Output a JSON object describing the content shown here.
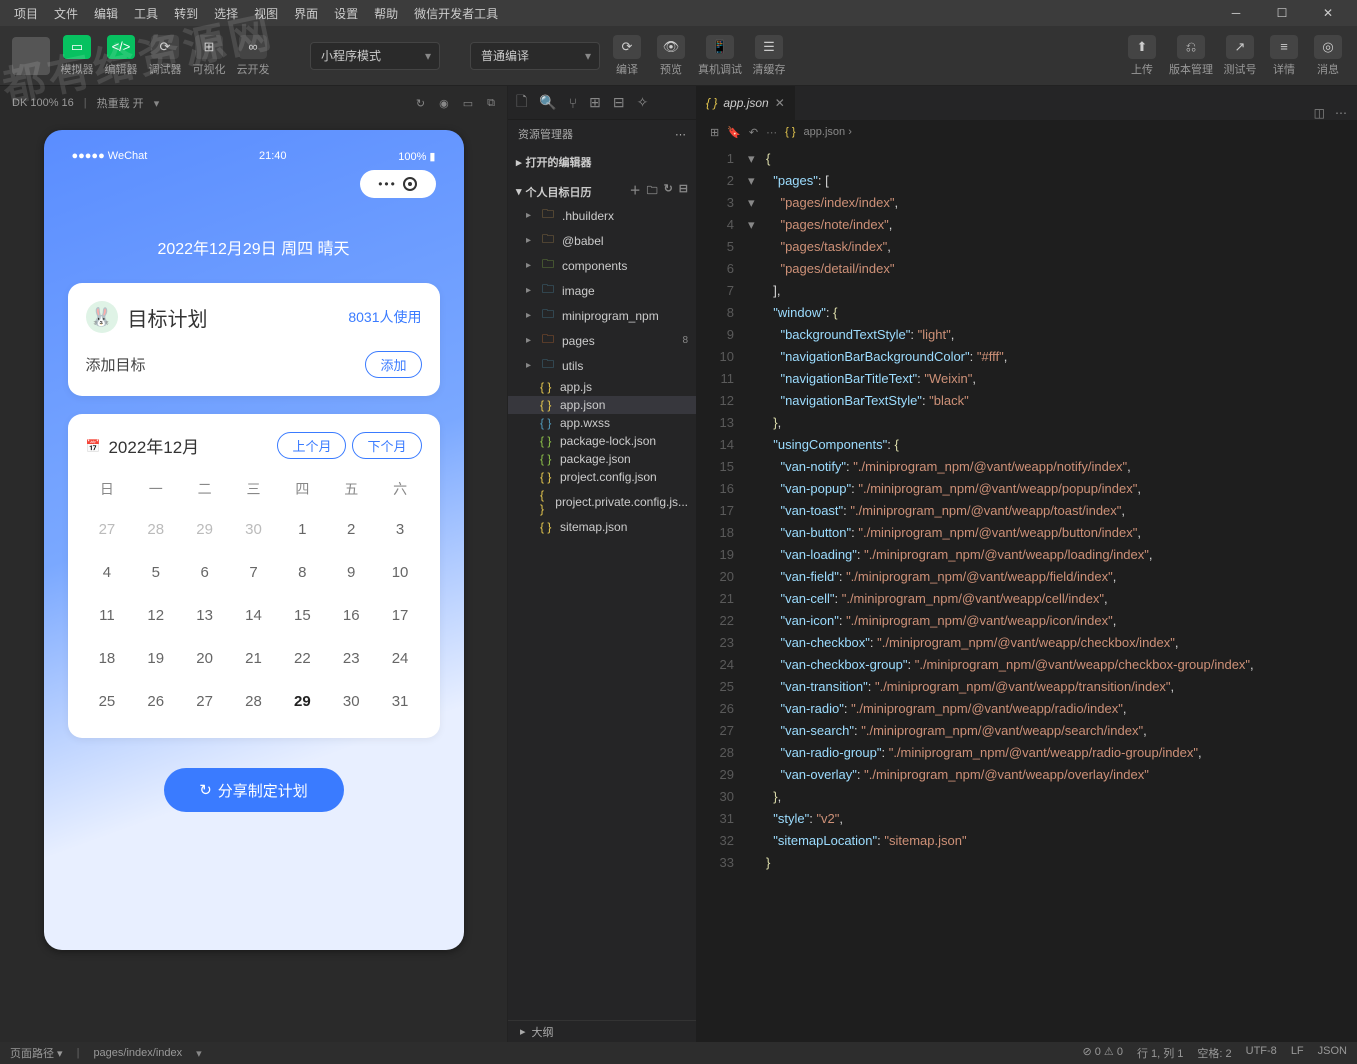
{
  "menubar": [
    "项目",
    "文件",
    "编辑",
    "工具",
    "转到",
    "选择",
    "视图",
    "界面",
    "设置",
    "帮助",
    "微信开发者工具"
  ],
  "toolbar": {
    "sim_label": "模拟器",
    "editor_label": "编辑器",
    "debugger_label": "调试器",
    "visual_label": "可视化",
    "cloud_label": "云开发",
    "mode": "小程序模式",
    "compile_mode": "普通编译",
    "compile": "编译",
    "preview": "预览",
    "remote": "真机调试",
    "clear": "清缓存",
    "upload": "上传",
    "version": "版本管理",
    "testid": "测试号",
    "detail": "详情",
    "msg": "消息"
  },
  "sim_header": {
    "device": "DK 100% 16",
    "hot": "热重载 开"
  },
  "phone": {
    "carrier": "●●●●● WeChat",
    "time": "21:40",
    "battery": "100%",
    "date": "2022年12月29日 周四 晴天",
    "card_title": "目标计划",
    "card_use": "8031人使用",
    "add_label": "添加目标",
    "add_btn": "添加",
    "month": "2022年12月",
    "prev": "上个月",
    "next": "下个月",
    "weekdays": [
      "日",
      "一",
      "二",
      "三",
      "四",
      "五",
      "六"
    ],
    "share": "分享制定计划"
  },
  "calendar_days": [
    {
      "n": 27,
      "in": false
    },
    {
      "n": 28,
      "in": false
    },
    {
      "n": 29,
      "in": false
    },
    {
      "n": 30,
      "in": false
    },
    {
      "n": 1,
      "in": true
    },
    {
      "n": 2,
      "in": true
    },
    {
      "n": 3,
      "in": true
    },
    {
      "n": 4,
      "in": true
    },
    {
      "n": 5,
      "in": true
    },
    {
      "n": 6,
      "in": true
    },
    {
      "n": 7,
      "in": true
    },
    {
      "n": 8,
      "in": true
    },
    {
      "n": 9,
      "in": true
    },
    {
      "n": 10,
      "in": true
    },
    {
      "n": 11,
      "in": true
    },
    {
      "n": 12,
      "in": true
    },
    {
      "n": 13,
      "in": true
    },
    {
      "n": 14,
      "in": true
    },
    {
      "n": 15,
      "in": true
    },
    {
      "n": 16,
      "in": true
    },
    {
      "n": 17,
      "in": true
    },
    {
      "n": 18,
      "in": true
    },
    {
      "n": 19,
      "in": true
    },
    {
      "n": 20,
      "in": true
    },
    {
      "n": 21,
      "in": true
    },
    {
      "n": 22,
      "in": true
    },
    {
      "n": 23,
      "in": true
    },
    {
      "n": 24,
      "in": true
    },
    {
      "n": 25,
      "in": true
    },
    {
      "n": 26,
      "in": true
    },
    {
      "n": 27,
      "in": true
    },
    {
      "n": 28,
      "in": true
    },
    {
      "n": 29,
      "in": true,
      "today": true
    },
    {
      "n": 30,
      "in": true
    },
    {
      "n": 31,
      "in": true
    }
  ],
  "explorer": {
    "title": "资源管理器",
    "open_editors": "打开的编辑器",
    "project": "个人目标日历",
    "outline": "大纲"
  },
  "tree": [
    {
      "t": "folder",
      "name": ".hbuilderx",
      "cls": "fico-fold"
    },
    {
      "t": "folder",
      "name": "@babel",
      "cls": "fico-fold"
    },
    {
      "t": "folder",
      "name": "components",
      "cls": "fico-fold",
      "col": "#8dc149"
    },
    {
      "t": "folder",
      "name": "image",
      "cls": "fico-fold",
      "col": "#519aba"
    },
    {
      "t": "folder",
      "name": "miniprogram_npm",
      "cls": "fico-fold",
      "col": "#519aba"
    },
    {
      "t": "folder",
      "name": "pages",
      "cls": "fico-fold",
      "col": "#e37933",
      "badge": "8"
    },
    {
      "t": "folder",
      "name": "utils",
      "cls": "fico-fold",
      "col": "#519aba"
    },
    {
      "t": "file",
      "name": "app.js",
      "cls": "fico-js",
      "col": "#e6c84f"
    },
    {
      "t": "file",
      "name": "app.json",
      "cls": "fico-json",
      "col": "#e6c84f",
      "sel": true
    },
    {
      "t": "file",
      "name": "app.wxss",
      "cls": "fico-css",
      "col": "#519aba"
    },
    {
      "t": "file",
      "name": "package-lock.json",
      "cls": "fico-json",
      "col": "#8dc149"
    },
    {
      "t": "file",
      "name": "package.json",
      "cls": "fico-json",
      "col": "#8dc149"
    },
    {
      "t": "file",
      "name": "project.config.json",
      "cls": "fico-cfg",
      "col": "#e6c84f"
    },
    {
      "t": "file",
      "name": "project.private.config.js...",
      "cls": "fico-cfg",
      "col": "#e6c84f"
    },
    {
      "t": "file",
      "name": "sitemap.json",
      "cls": "fico-json",
      "col": "#e6c84f"
    }
  ],
  "tab": {
    "name": "app.json"
  },
  "crumbs": {
    "file": "app.json"
  },
  "code_lines": [
    {
      "n": 1,
      "fold": "▾",
      "html": "<span class='tok-b'>{</span>"
    },
    {
      "n": 2,
      "fold": "▾",
      "html": "  <span class='tok-k'>\"pages\"</span><span class='tok-p'>: [</span>"
    },
    {
      "n": 3,
      "html": "    <span class='tok-s'>\"pages/index/index\"</span><span class='tok-p'>,</span>"
    },
    {
      "n": 4,
      "html": "    <span class='tok-s'>\"pages/note/index\"</span><span class='tok-p'>,</span>"
    },
    {
      "n": 5,
      "html": "    <span class='tok-s'>\"pages/task/index\"</span><span class='tok-p'>,</span>"
    },
    {
      "n": 6,
      "html": "    <span class='tok-s'>\"pages/detail/index\"</span>"
    },
    {
      "n": 7,
      "html": "  <span class='tok-p'>],</span>"
    },
    {
      "n": 8,
      "fold": "▾",
      "html": "  <span class='tok-k'>\"window\"</span><span class='tok-p'>: </span><span class='tok-b'>{</span>"
    },
    {
      "n": 9,
      "html": "    <span class='tok-k'>\"backgroundTextStyle\"</span><span class='tok-p'>: </span><span class='tok-s'>\"light\"</span><span class='tok-p'>,</span>"
    },
    {
      "n": 10,
      "html": "    <span class='tok-k'>\"navigationBarBackgroundColor\"</span><span class='tok-p'>: </span><span class='tok-s'>\"#fff\"</span><span class='tok-p'>,</span>"
    },
    {
      "n": 11,
      "html": "    <span class='tok-k'>\"navigationBarTitleText\"</span><span class='tok-p'>: </span><span class='tok-s'>\"Weixin\"</span><span class='tok-p'>,</span>"
    },
    {
      "n": 12,
      "html": "    <span class='tok-k'>\"navigationBarTextStyle\"</span><span class='tok-p'>: </span><span class='tok-s'>\"black\"</span>"
    },
    {
      "n": 13,
      "html": "  <span class='tok-b'>}</span><span class='tok-p'>,</span>"
    },
    {
      "n": 14,
      "fold": "▾",
      "html": "  <span class='tok-k'>\"usingComponents\"</span><span class='tok-p'>: </span><span class='tok-b'>{</span>"
    },
    {
      "n": 15,
      "html": "    <span class='tok-k'>\"van-notify\"</span><span class='tok-p'>: </span><span class='tok-s'>\"./miniprogram_npm/@vant/weapp/notify/index\"</span><span class='tok-p'>,</span>"
    },
    {
      "n": 16,
      "html": "    <span class='tok-k'>\"van-popup\"</span><span class='tok-p'>: </span><span class='tok-s'>\"./miniprogram_npm/@vant/weapp/popup/index\"</span><span class='tok-p'>,</span>"
    },
    {
      "n": 17,
      "html": "    <span class='tok-k'>\"van-toast\"</span><span class='tok-p'>: </span><span class='tok-s'>\"./miniprogram_npm/@vant/weapp/toast/index\"</span><span class='tok-p'>,</span>"
    },
    {
      "n": 18,
      "html": "    <span class='tok-k'>\"van-button\"</span><span class='tok-p'>: </span><span class='tok-s'>\"./miniprogram_npm/@vant/weapp/button/index\"</span><span class='tok-p'>,</span>"
    },
    {
      "n": 19,
      "html": "    <span class='tok-k'>\"van-loading\"</span><span class='tok-p'>: </span><span class='tok-s'>\"./miniprogram_npm/@vant/weapp/loading/index\"</span><span class='tok-p'>,</span>"
    },
    {
      "n": 20,
      "html": "    <span class='tok-k'>\"van-field\"</span><span class='tok-p'>: </span><span class='tok-s'>\"./miniprogram_npm/@vant/weapp/field/index\"</span><span class='tok-p'>,</span>"
    },
    {
      "n": 21,
      "html": "    <span class='tok-k'>\"van-cell\"</span><span class='tok-p'>: </span><span class='tok-s'>\"./miniprogram_npm/@vant/weapp/cell/index\"</span><span class='tok-p'>,</span>"
    },
    {
      "n": 22,
      "html": "    <span class='tok-k'>\"van-icon\"</span><span class='tok-p'>: </span><span class='tok-s'>\"./miniprogram_npm/@vant/weapp/icon/index\"</span><span class='tok-p'>,</span>"
    },
    {
      "n": 23,
      "html": "    <span class='tok-k'>\"van-checkbox\"</span><span class='tok-p'>: </span><span class='tok-s'>\"./miniprogram_npm/@vant/weapp/checkbox/index\"</span><span class='tok-p'>,</span>"
    },
    {
      "n": 24,
      "html": "    <span class='tok-k'>\"van-checkbox-group\"</span><span class='tok-p'>: </span><span class='tok-s'>\"./miniprogram_npm/@vant/weapp/checkbox-group/index\"</span><span class='tok-p'>,</span>"
    },
    {
      "n": 25,
      "html": "    <span class='tok-k'>\"van-transition\"</span><span class='tok-p'>: </span><span class='tok-s'>\"./miniprogram_npm/@vant/weapp/transition/index\"</span><span class='tok-p'>,</span>"
    },
    {
      "n": 26,
      "html": "    <span class='tok-k'>\"van-radio\"</span><span class='tok-p'>: </span><span class='tok-s'>\"./miniprogram_npm/@vant/weapp/radio/index\"</span><span class='tok-p'>,</span>"
    },
    {
      "n": 27,
      "html": "    <span class='tok-k'>\"van-search\"</span><span class='tok-p'>: </span><span class='tok-s'>\"./miniprogram_npm/@vant/weapp/search/index\"</span><span class='tok-p'>,</span>"
    },
    {
      "n": 28,
      "html": "    <span class='tok-k'>\"van-radio-group\"</span><span class='tok-p'>: </span><span class='tok-s'>\"./miniprogram_npm/@vant/weapp/radio-group/index\"</span><span class='tok-p'>,</span>"
    },
    {
      "n": 29,
      "html": "    <span class='tok-k'>\"van-overlay\"</span><span class='tok-p'>: </span><span class='tok-s'>\"./miniprogram_npm/@vant/weapp/overlay/index\"</span>"
    },
    {
      "n": 30,
      "html": "  <span class='tok-b'>}</span><span class='tok-p'>,</span>"
    },
    {
      "n": 31,
      "html": "  <span class='tok-k'>\"style\"</span><span class='tok-p'>: </span><span class='tok-s'>\"v2\"</span><span class='tok-p'>,</span>"
    },
    {
      "n": 32,
      "html": "  <span class='tok-k'>\"sitemapLocation\"</span><span class='tok-p'>: </span><span class='tok-s'>\"sitemap.json\"</span>"
    },
    {
      "n": 33,
      "html": "<span class='tok-b'>}</span>"
    }
  ],
  "status": {
    "route_label": "页面路径",
    "route": "pages/index/index",
    "errors": "⊘ 0 ⚠ 0",
    "pos": "行 1, 列 1",
    "spaces": "空格: 2",
    "enc": "UTF-8",
    "eol": "LF",
    "lang": "JSON"
  },
  "watermark": "都有给资源网"
}
